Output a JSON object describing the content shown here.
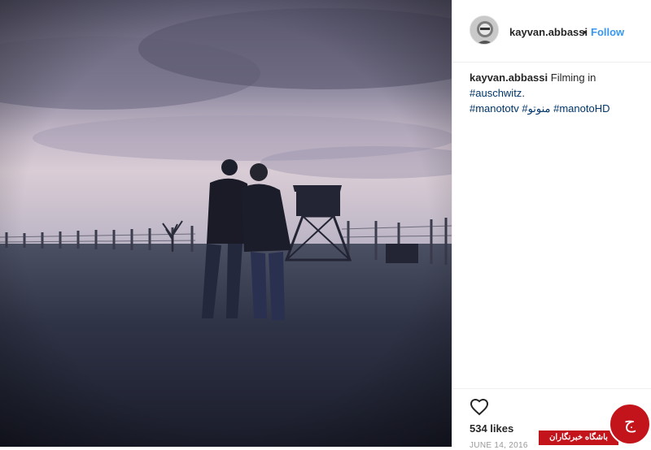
{
  "post": {
    "username": "kayvan.abbassi",
    "separator": "•",
    "follow_label": "Follow",
    "caption": {
      "username": "kayvan.abbassi",
      "text_before": "Filming in ",
      "tags": [
        "#auschwitz",
        "#manototv",
        "#منوتو",
        "#manotoHD"
      ],
      "period": "."
    },
    "likes": "534 likes",
    "date": "JUNE 14, 2016"
  },
  "watermark": {
    "bar_text": "باشگاه خبرنگاران",
    "glyph": "ج"
  },
  "icons": {
    "heart": "heart-outline-icon",
    "avatar": "user-avatar"
  },
  "colors": {
    "link": "#3897f0",
    "hashtag": "#003569",
    "watermark": "#c3141b"
  }
}
